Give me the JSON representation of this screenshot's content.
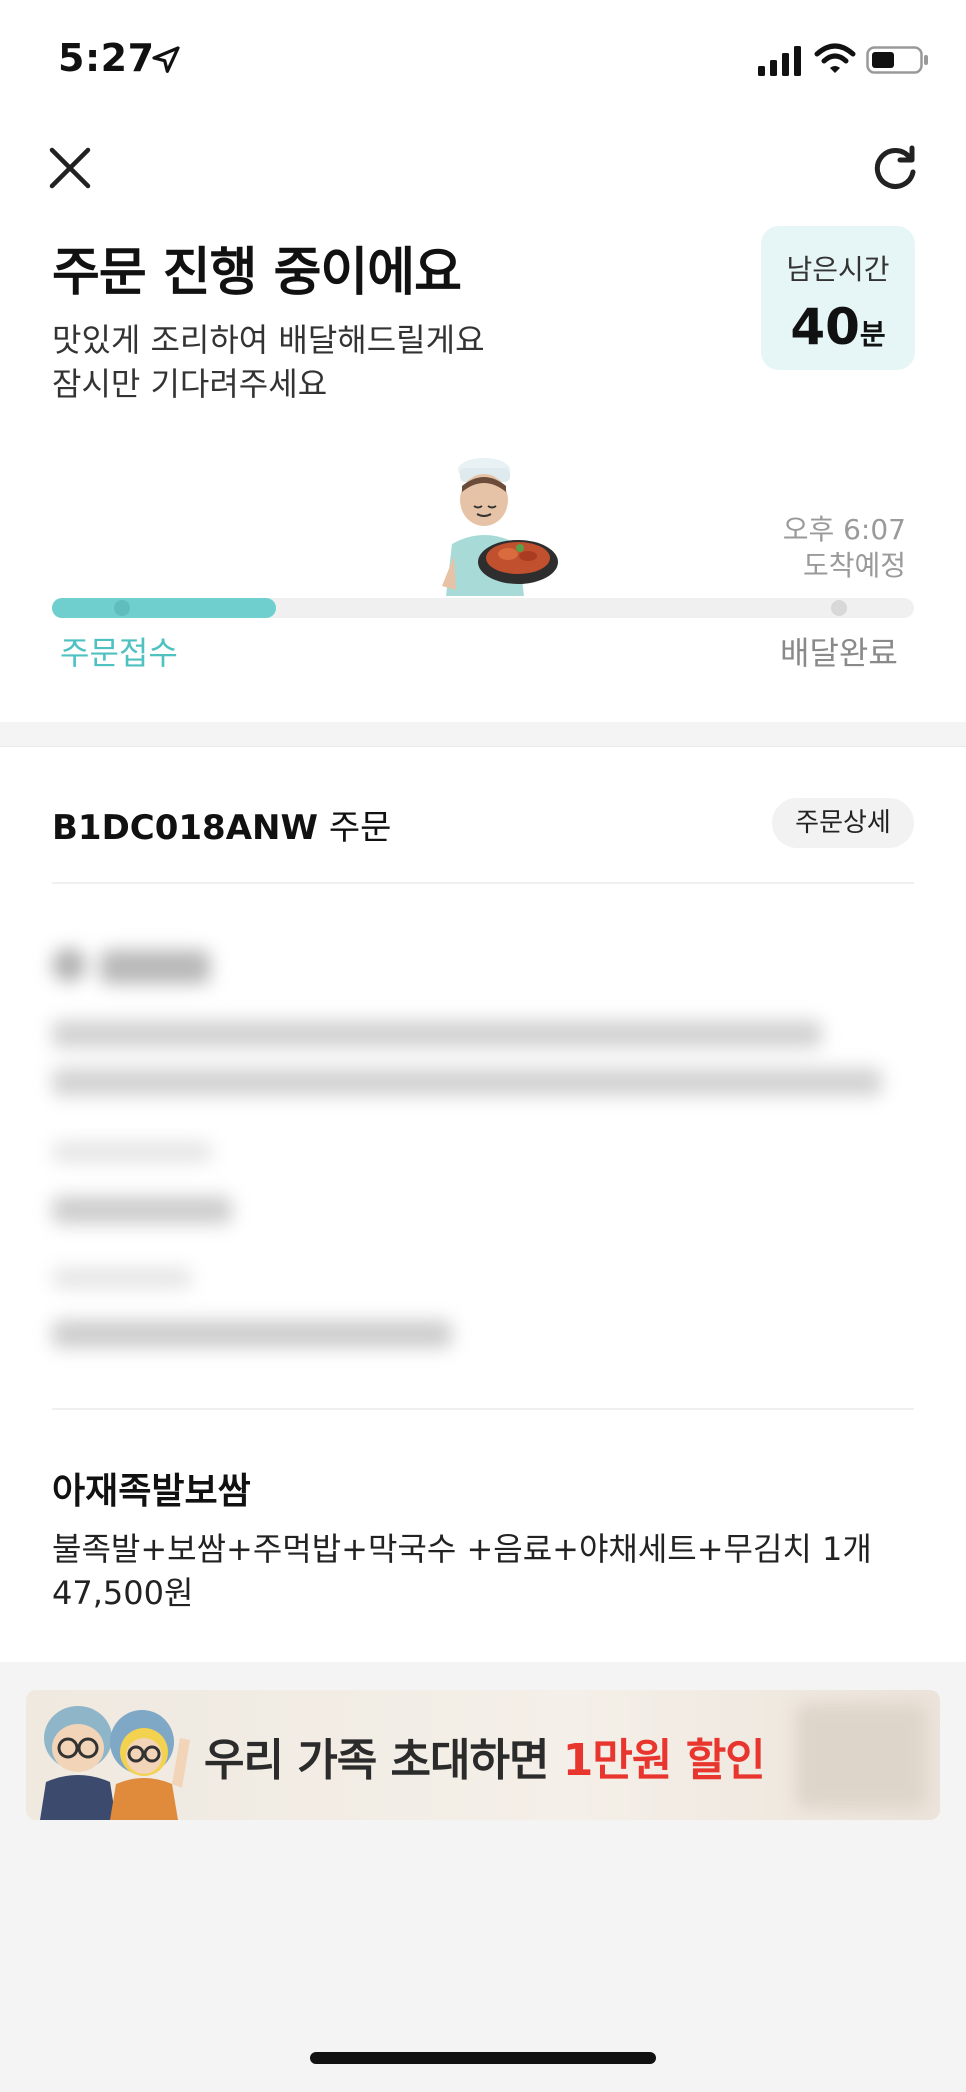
{
  "status_bar": {
    "time": "5:27"
  },
  "header": {
    "title": "주문 진행 중이에요",
    "subtitle_line1": "맛있게 조리하여 배달해드릴게요",
    "subtitle_line2": "잠시만 기다려주세요",
    "remaining_label": "남은시간",
    "remaining_value": "40",
    "remaining_unit": "분"
  },
  "progress": {
    "eta_time": "오후 6:07",
    "eta_label": "도착예정",
    "fraction": 0.26,
    "step_start": "주문접수",
    "step_end": "배달완료",
    "accent_color": "#6fcfcf"
  },
  "order": {
    "id": "B1DC018ANW",
    "suffix": "주문",
    "detail_button": "주문상세",
    "store_name": "아재족발보쌈",
    "menu": "불족발+보쌈+주먹밥+막국수 +음료+야채세트+무김치 1개",
    "price": "47,500원"
  },
  "banner": {
    "text_prefix": "우리 가족 초대하면 ",
    "text_highlight": "1만원 할인",
    "highlight_color": "#e8352e"
  },
  "icons": [
    "location-arrow-icon",
    "signal-icon",
    "wifi-icon",
    "battery-icon",
    "close-icon",
    "refresh-icon"
  ]
}
